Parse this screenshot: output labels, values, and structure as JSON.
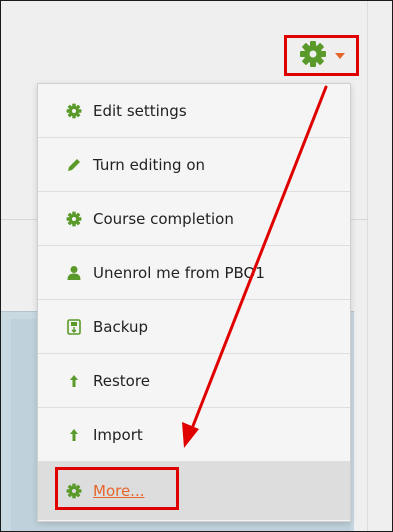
{
  "menu": {
    "items": [
      {
        "label": "Edit settings",
        "icon": "gear-icon"
      },
      {
        "label": "Turn editing on",
        "icon": "pencil-icon"
      },
      {
        "label": "Course completion",
        "icon": "gear-icon"
      },
      {
        "label": "Unenrol me from PBO1",
        "icon": "user-icon"
      },
      {
        "label": "Backup",
        "icon": "backup-icon"
      },
      {
        "label": "Restore",
        "icon": "upload-arrow-icon"
      },
      {
        "label": "Import",
        "icon": "upload-arrow-icon"
      },
      {
        "label": "More...",
        "icon": "gear-icon"
      }
    ]
  },
  "colors": {
    "icon_green": "#5a9a2a",
    "accent_orange": "#e5662d",
    "highlight_red": "#e00000"
  }
}
